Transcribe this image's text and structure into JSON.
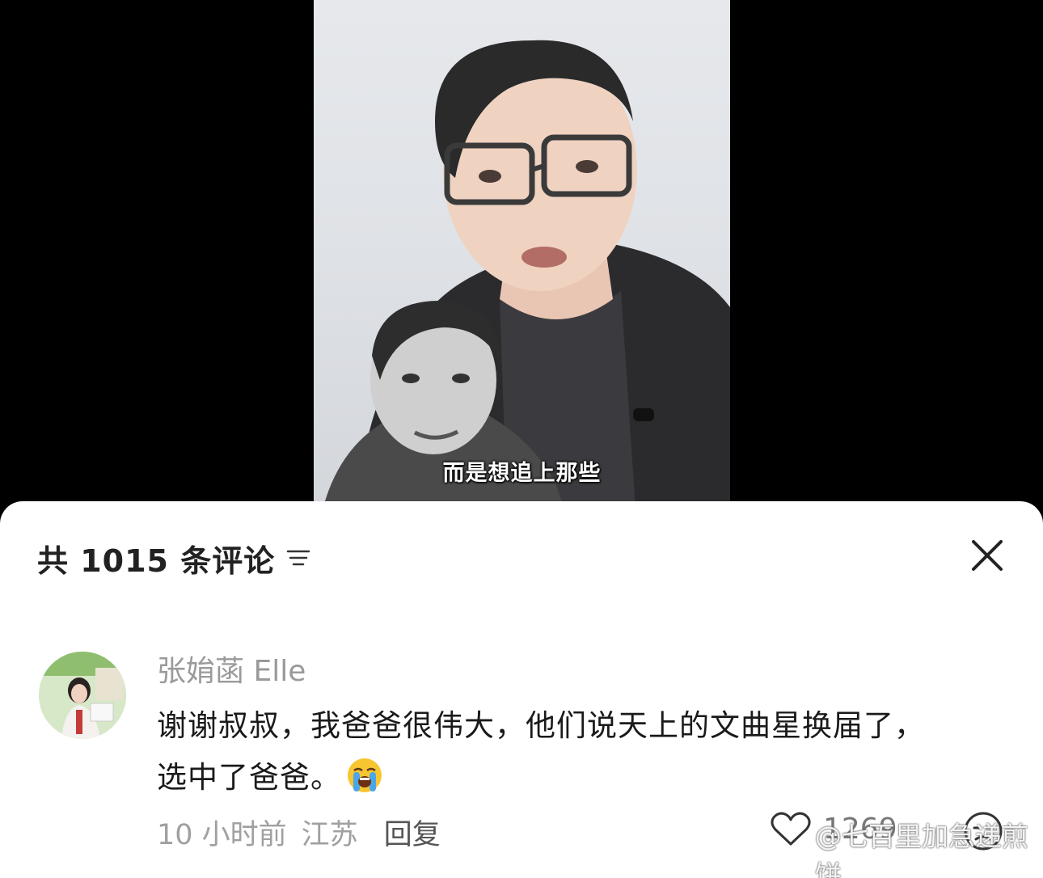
{
  "video": {
    "subtitle": "而是想追上那些"
  },
  "comments_panel": {
    "count_label": "共 1015 条评论",
    "sort_icon": "filter-lines-icon",
    "close_icon": "close-icon",
    "comment": {
      "username": "张姢菡 Elle",
      "text_line1": "谢谢叔叔，我爸爸很伟大，他们说天上的文曲星换届了，",
      "text_line2": "选中了爸爸。",
      "emoji": "loudly-crying-face-emoji",
      "time": "10 小时前",
      "location": "江苏",
      "reply_label": "回复",
      "like_count": "1269",
      "like_icon": "heart-outline-icon",
      "dislike_icon": "unhappy-face-icon"
    }
  },
  "watermark": {
    "text": "@七百里加急递煎饼",
    "logo": "weibo-logo"
  },
  "colors": {
    "sheet_bg": "#ffffff",
    "username": "#9a9a9a",
    "meta": "#a0a0a0",
    "text": "#1a1a1a",
    "emoji_yellow": "#f7c531"
  }
}
